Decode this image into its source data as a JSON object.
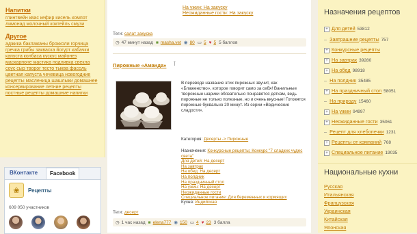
{
  "sidebar": {
    "categories": [
      {
        "title": "Напитки",
        "links": "глинтвейн квас кефир кисель компот лимонад молочный коктейль смузи"
      },
      {
        "title": "Другое",
        "links": "аджика баклажаны брокколи горчица гречка грибы закваска йогурт кабачки капуста колбаса кускус майонез маскарпоне мастика подливка свекла соус сыр творог тесто тыква фасоль цветная капуста чечевица новогодние рецепты масленица шашлыки домашнее консервирование летние рецепты постные рецепты домашние напитки"
      }
    ],
    "social": {
      "tabs": [
        "ВКонтакте",
        "Facebook"
      ],
      "group_name": "Рецепты",
      "members": "609 050 участников"
    }
  },
  "feed": {
    "prev_links": [
      "На ужин: На закуску",
      "Неожиданные гости: На закуску"
    ],
    "prev_tags_label": "Теги:",
    "prev_tags": "салат закуска",
    "prev_meta": {
      "time": "47 минут назад",
      "author": "masha.vet",
      "views": "80",
      "comments": "5",
      "likes": "5",
      "score": "5 баллов"
    },
    "post": {
      "title": "Пирожные «Аманда»",
      "description": "В переводе название этих пирожных звучит, как «Блаженство», которое говорит само за себя! Ванильные творожные шарики обязательно понравятся деткам, ведь пирожные не только полезные, но и очень вкусные! Готовятся пирожные буквально 20 минут. Из серии «Ведические сладости».",
      "category_label": "Категория:",
      "category": "Десерты -> Пирожные",
      "purpose_label": "Назначения:",
      "purposes": [
        "Конкурсные рецепты; Конкурс \"7 сладких чудес света\"",
        "Для детей: На десерт",
        "На завтрак",
        "На обед: На десерт",
        "На полдник",
        "На праздничный стол",
        "На ужин: На десерт",
        "Неожиданные гости",
        "Специальное питание: Для беременных и кормящих"
      ],
      "cuisine_label": "Кухня:",
      "cuisine": "Индийская",
      "tags_label": "Теги:",
      "tags": "десерт",
      "meta": {
        "time": "1 час назад",
        "author": "elena777",
        "views": "150",
        "comments": "4",
        "likes": "23",
        "score": "3 балла"
      }
    }
  },
  "right": {
    "purposes_title": "Назначения рецептов",
    "purposes": [
      {
        "marker": "+",
        "label": "Для детей",
        "count": "53812"
      },
      {
        "marker": "–",
        "label": "Завтрашние рецепты",
        "count": "757"
      },
      {
        "marker": "+",
        "label": "Конкурсные рецепты",
        "count": ""
      },
      {
        "marker": "+",
        "label": "На завтрак",
        "count": "39280"
      },
      {
        "marker": "+",
        "label": "На обед",
        "count": "98918"
      },
      {
        "marker": "–",
        "label": "На полдник",
        "count": "35485"
      },
      {
        "marker": "+",
        "label": "На праздничный стол",
        "count": "58051"
      },
      {
        "marker": "–",
        "label": "На природу",
        "count": "15460"
      },
      {
        "marker": "+",
        "label": "На ужин",
        "count": "94997"
      },
      {
        "marker": "+",
        "label": "Неожиданные гости",
        "count": "35061"
      },
      {
        "marker": "–",
        "label": "Рецепт для хлебопечки",
        "count": "1231"
      },
      {
        "marker": "+",
        "label": "Рецепты от компаний",
        "count": "768"
      },
      {
        "marker": "+",
        "label": "Специальное питание",
        "count": "19035"
      }
    ],
    "cuisines_title": "Национальные кухни",
    "cuisines": [
      "Русская",
      "Итальянская",
      "Французская",
      "Украинская",
      "Китайская",
      "Японская"
    ]
  },
  "colors": {
    "link": "#c07a00",
    "sidebar_bg": "#fbf3c2",
    "page_bg": "#f3efe4",
    "vk_blue": "#3b5998"
  }
}
